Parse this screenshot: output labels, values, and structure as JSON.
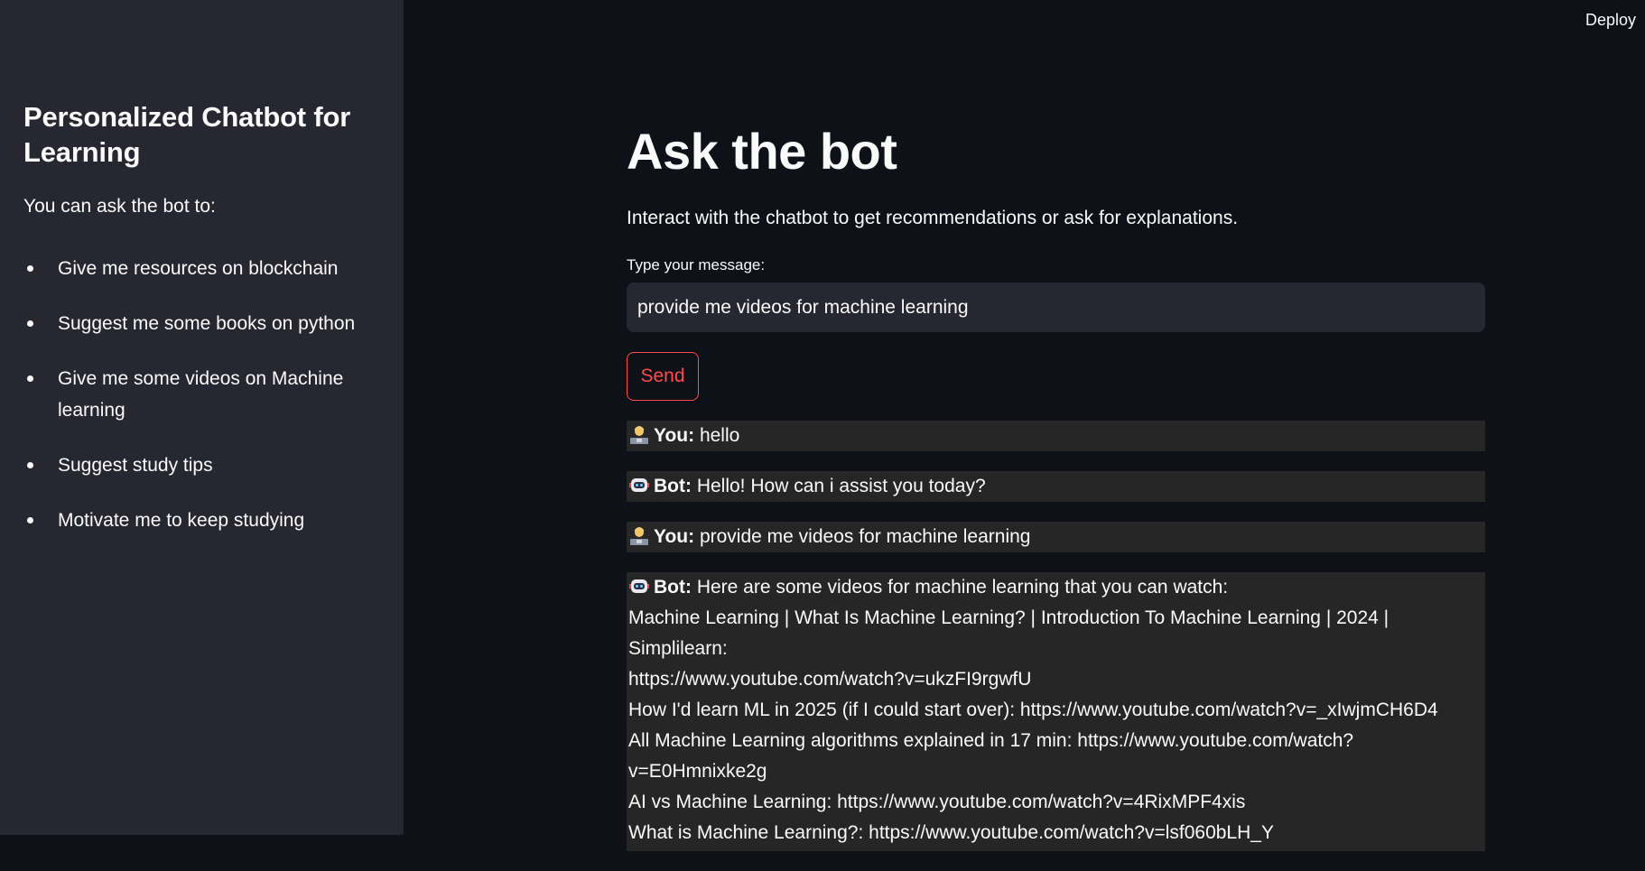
{
  "sidebar": {
    "title": "Personalized Chatbot for Learning",
    "intro": "You can ask the bot to:",
    "items": [
      "Give me resources on blockchain",
      "Suggest me some books on python",
      "Give me some videos on Machine learning",
      "Suggest study tips",
      "Motivate me to keep studying"
    ]
  },
  "header": {
    "deploy_label": "Deploy"
  },
  "main": {
    "title": "Ask the bot",
    "subtitle": "Interact with the chatbot to get recommendations or ask for explanations.",
    "input_label": "Type your message:",
    "input_value": "provide me videos for machine learning",
    "send_label": "Send"
  },
  "chat": {
    "messages": [
      {
        "speaker": "You:",
        "text": "hello"
      },
      {
        "speaker": "Bot:",
        "text": "Hello! How can i assist you today?"
      },
      {
        "speaker": "You:",
        "text": "provide me videos for machine learning"
      },
      {
        "speaker": "Bot:",
        "text": "Here are some videos for machine learning that you can watch:",
        "lines": [
          "Machine Learning | What Is Machine Learning? | Introduction To Machine Learning | 2024 | Simplilearn:",
          "https://www.youtube.com/watch?v=ukzFI9rgwfU",
          "How I'd learn ML in 2025 (if I could start over): https://www.youtube.com/watch?v=_xIwjmCH6D4",
          "All Machine Learning algorithms explained in 17 min: https://www.youtube.com/watch?v=E0Hmnixke2g",
          "AI vs Machine Learning: https://www.youtube.com/watch?v=4RixMPF4xis",
          "What is Machine Learning?: https://www.youtube.com/watch?v=lsf060bLH_Y"
        ]
      }
    ]
  },
  "icons": {
    "user_avatar": "user-technologist-icon",
    "bot_avatar": "robot-icon"
  },
  "colors": {
    "background": "#0e1117",
    "sidebar": "#262730",
    "accent": "#ff4b4b",
    "message_bg": "#262626"
  }
}
